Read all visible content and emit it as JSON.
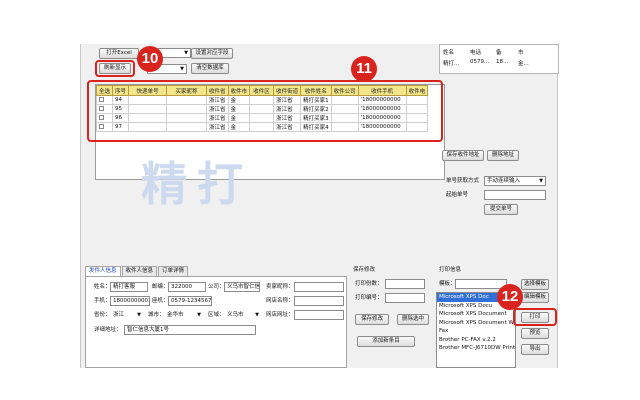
{
  "toolbar": {
    "open_excel": "打开Excel",
    "refresh": "刷新显示",
    "set_fields": "设置对应字段",
    "clear_db": "清空数据库"
  },
  "grid": {
    "headers": [
      "全选",
      "序号",
      "快递单号",
      "买家昵称",
      "收件省",
      "收件市",
      "收件区",
      "收件街道",
      "收件姓名",
      "收件公司",
      "收件手机",
      "收件电"
    ],
    "rows": [
      [
        "94",
        "",
        "",
        "浙江省",
        "金",
        "",
        "浙江省",
        "精打买家1",
        "",
        "'18000000000"
      ],
      [
        "95",
        "",
        "",
        "浙江省",
        "金",
        "",
        "浙江省",
        "精打买家2",
        "",
        "'18000000000"
      ],
      [
        "96",
        "",
        "",
        "浙江省",
        "金",
        "",
        "浙江省",
        "精打买家3",
        "",
        "'18000000000"
      ],
      [
        "97",
        "",
        "",
        "浙江省",
        "金",
        "",
        "浙江省",
        "精打买家4",
        "",
        "'18000000000"
      ]
    ]
  },
  "watermark": "精打",
  "right_panel": {
    "table_headers": [
      "姓名",
      "电话",
      "备",
      "市"
    ],
    "table_row": [
      "精打...",
      "0579...",
      "18...",
      "金..."
    ],
    "save_address": "保存收件地址",
    "delete_address": "删除地址",
    "single_mode_label": "单号获取方式",
    "single_mode_value": "手动连续输入",
    "start_no_label": "起始单号",
    "submit_no": "提交单号"
  },
  "tabs": [
    "发件人信息",
    "收件人信息",
    "订单详情"
  ],
  "sender": {
    "name_label": "姓名：",
    "name_value": "精打客服",
    "zip_label": "邮编：",
    "zip_value": "322000",
    "company_label": "公司：",
    "company_value": "义乌市智仁信息",
    "seller_label": "卖家昵称：",
    "phone_label": "手机：",
    "phone_value": "18000000001",
    "tel_label": "座机：",
    "tel_value": "0579-1234567",
    "shop_label": "网店名称：",
    "province_label": "省份：",
    "province_value": "浙江",
    "city_label": "城市：",
    "city_value": "金华市",
    "district_label": "区域：",
    "district_value": "义乌市",
    "url_label": "网店网址：",
    "address_label": "详细地址：",
    "address_value": "智仁信息大厦1号"
  },
  "save_modify": {
    "title": "保存修改",
    "print_count_label": "打印份数：",
    "print_no_label": "打印编号：",
    "save_btn": "保存修改",
    "delete_btn": "删除选中",
    "add_btn": "添加新条目"
  },
  "print_info": {
    "title": "打印信息",
    "template_label": "模板：",
    "printers": [
      "Microsoft XPS Doc",
      "Microsoft XPS Docu",
      "Microsoft XPS Document",
      "Microsoft XPS Document W",
      "Fax",
      "Brother PC-FAX v.2.2",
      "Brother MFC-J6710DW Printe"
    ],
    "choose_template": "选择模板",
    "edit_template": "编辑模板",
    "print_btn": "打印",
    "preview_btn": "预览",
    "export_btn": "导出"
  },
  "badges": [
    "10",
    "11",
    "12"
  ],
  "colors": {
    "accent_red": "#d9231d",
    "header_yellow": "#f3e58a",
    "selection_blue": "#3170d8"
  }
}
